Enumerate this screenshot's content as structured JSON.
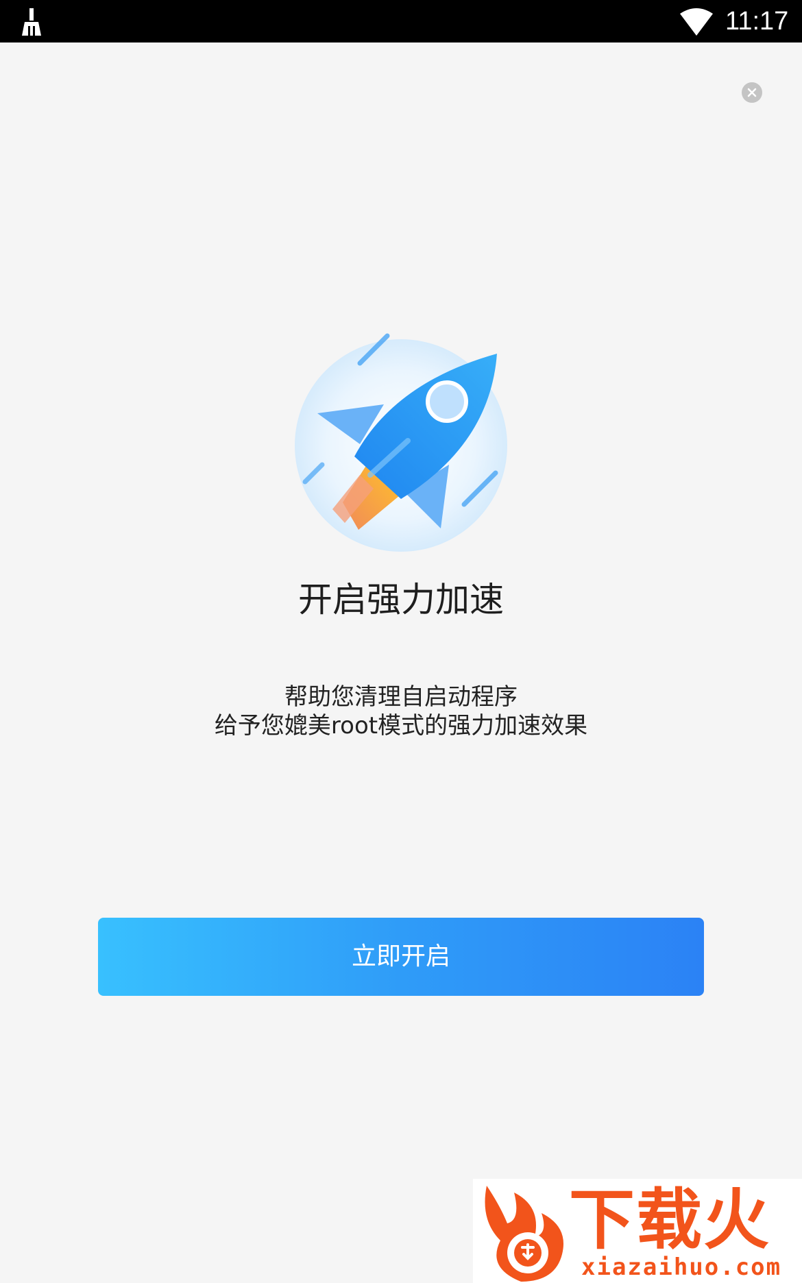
{
  "status_bar": {
    "time": "11:17",
    "left_icon": "broom-icon",
    "right_icon": "wifi-icon"
  },
  "dialog": {
    "close_icon": "close-icon",
    "illustration": "rocket-icon",
    "title": "开启强力加速",
    "description_lines": [
      "帮助您清理自启动程序",
      "给予您媲美root模式的强力加速效果"
    ],
    "button_label": "立即开启"
  },
  "watermark": {
    "brand": "下载火",
    "site": "xiazaihuo.com"
  },
  "colors": {
    "background": "#f5f5f5",
    "button_gradient_start": "#38c0fe",
    "button_gradient_end": "#2b82f5",
    "watermark": "#f2541b"
  }
}
